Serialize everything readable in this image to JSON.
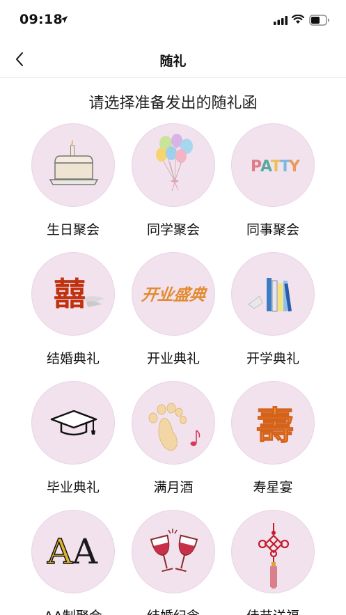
{
  "status": {
    "time": "09:18"
  },
  "nav": {
    "title": "随礼"
  },
  "heading": "请选择准备发出的随礼函",
  "tiles": [
    {
      "label": "生日聚会",
      "icon": "birthday-cake-icon"
    },
    {
      "label": "同学聚会",
      "icon": "balloons-icon"
    },
    {
      "label": "同事聚会",
      "icon": "party-text-icon",
      "art_text": "PATTY"
    },
    {
      "label": "结婚典礼",
      "icon": "double-happiness-icon",
      "art_text": "囍"
    },
    {
      "label": "开业典礼",
      "icon": "grand-opening-icon",
      "art_text": "开业盛典"
    },
    {
      "label": "开学典礼",
      "icon": "books-icon"
    },
    {
      "label": "毕业典礼",
      "icon": "graduation-cap-icon"
    },
    {
      "label": "满月酒",
      "icon": "baby-foot-icon"
    },
    {
      "label": "寿星宴",
      "icon": "longevity-icon",
      "art_text": "壽"
    },
    {
      "label": "AA制聚会",
      "icon": "aa-letters-icon",
      "art_text": "AA"
    },
    {
      "label": "结婚纪念",
      "icon": "wine-glasses-icon"
    },
    {
      "label": "佳节送福",
      "icon": "chinese-knot-icon"
    }
  ],
  "colors": {
    "circle_bg": "#f1e2ee",
    "circle_border": "#e9d3e4",
    "divider": "#ececec"
  }
}
